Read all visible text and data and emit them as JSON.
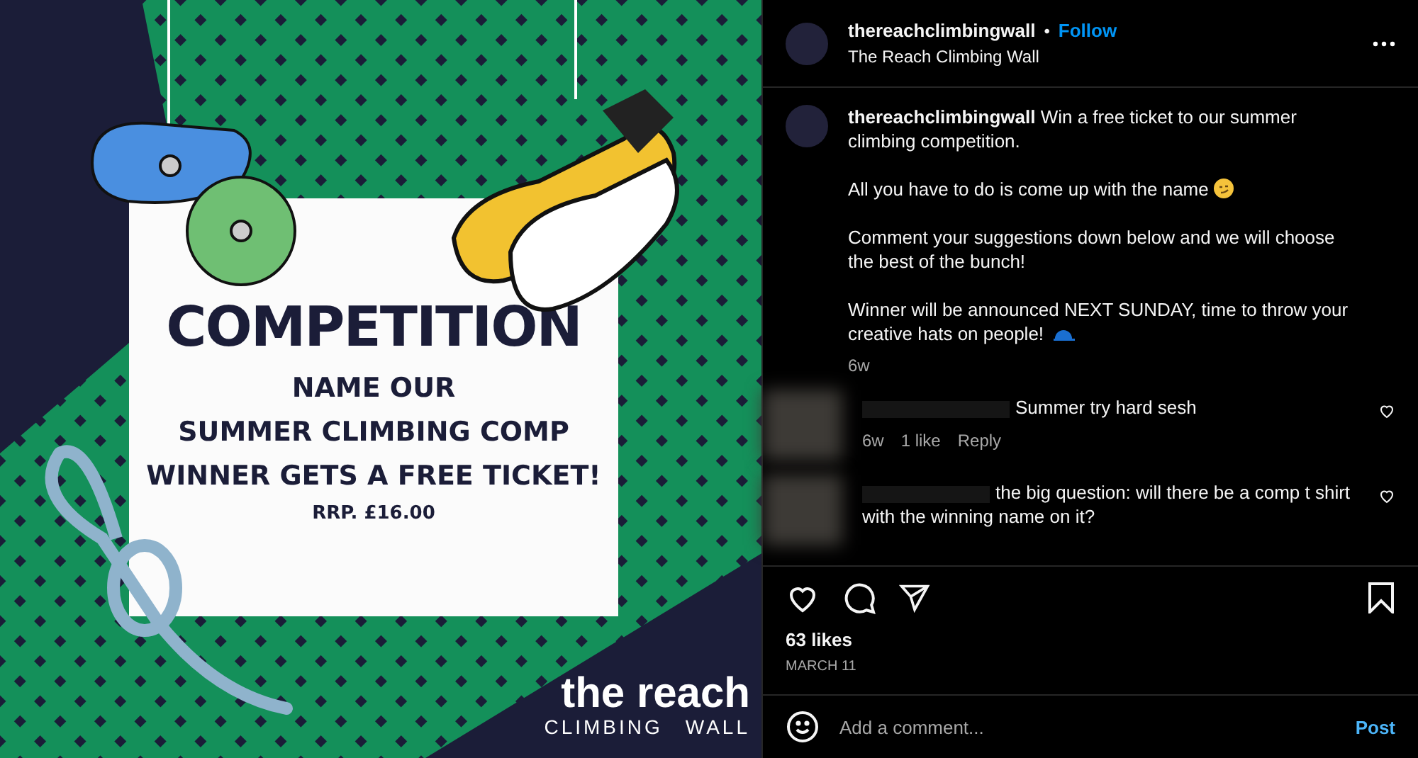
{
  "poster": {
    "title": "COMPETITION",
    "lines": [
      "NAME OUR",
      "SUMMER CLIMBING COMP",
      "WINNER GETS A FREE TICKET!"
    ],
    "price": "RRP. £16.00",
    "logo_top": "the reach",
    "logo_left": "CLIMBING",
    "logo_right": "WALL"
  },
  "header": {
    "username": "thereachclimbingwall",
    "separator": "•",
    "follow": "Follow",
    "subtitle": "The Reach Climbing Wall"
  },
  "caption": {
    "username": "thereachclimbingwall",
    "paragraphs": [
      {
        "text": "Win a free ticket to our summer climbing competition.",
        "kind": "plain"
      },
      {
        "text": "All you have to do is come up with the name",
        "kind": "smirk"
      },
      {
        "text": "Comment your suggestions down below and we will choose the best of the bunch!",
        "kind": "plain"
      },
      {
        "text": "Winner will be announced NEXT SUNDAY, time to throw your creative hats on people!",
        "kind": "cap"
      }
    ],
    "age": "6w"
  },
  "comments": [
    {
      "text": "Summer try hard sesh",
      "meta": [
        "6w",
        "1 like",
        "Reply"
      ],
      "liked": false
    },
    {
      "text": "the big question: will there be a comp t shirt with the winning name on it?",
      "liked": false
    }
  ],
  "actions": {
    "liked": false,
    "saved": false
  },
  "likes": "63 likes",
  "date": "MARCH 11",
  "comment_box": {
    "placeholder": "Add a comment...",
    "post": "Post"
  }
}
